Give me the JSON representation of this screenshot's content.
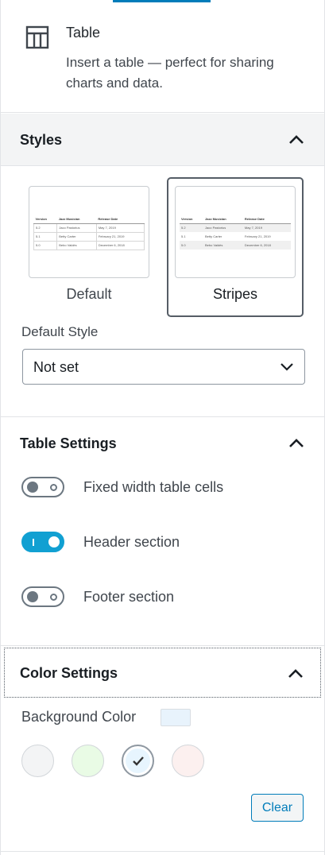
{
  "block": {
    "title": "Table",
    "description": "Insert a table — perfect for sharing charts and data.",
    "icon": "table-icon"
  },
  "styles_panel": {
    "title": "Styles",
    "expanded": true,
    "options": [
      {
        "label": "Default",
        "selected": false
      },
      {
        "label": "Stripes",
        "selected": true
      }
    ],
    "preview_table": {
      "headers": [
        "Version",
        "Jazz Musician",
        "Release Date"
      ],
      "rows": [
        [
          "5.2",
          "Jaco Pastorius",
          "May 7, 2019"
        ],
        [
          "5.1",
          "Betty Carter",
          "February 21, 2019"
        ],
        [
          "5.0",
          "Bebo Valdés",
          "December 6, 2018"
        ]
      ]
    },
    "default_style_label": "Default Style",
    "default_style_value": "Not set"
  },
  "table_settings": {
    "title": "Table Settings",
    "expanded": true,
    "toggles": [
      {
        "label": "Fixed width table cells",
        "on": false
      },
      {
        "label": "Header section",
        "on": true
      },
      {
        "label": "Footer section",
        "on": false
      }
    ]
  },
  "color_settings": {
    "title": "Color Settings",
    "expanded": true,
    "background_label": "Background Color",
    "current_color": "#e8f3fc",
    "palette": [
      {
        "color": "#f3f4f5",
        "selected": false
      },
      {
        "color": "#e9fbe5",
        "selected": false
      },
      {
        "color": "#e7f5fe",
        "selected": true
      },
      {
        "color": "#fcf0ef",
        "selected": false
      }
    ],
    "clear_label": "Clear"
  },
  "colors": {
    "accent": "#007cba",
    "toggle_on": "#11a0d2",
    "panel_header_bg": "#f3f4f5"
  }
}
